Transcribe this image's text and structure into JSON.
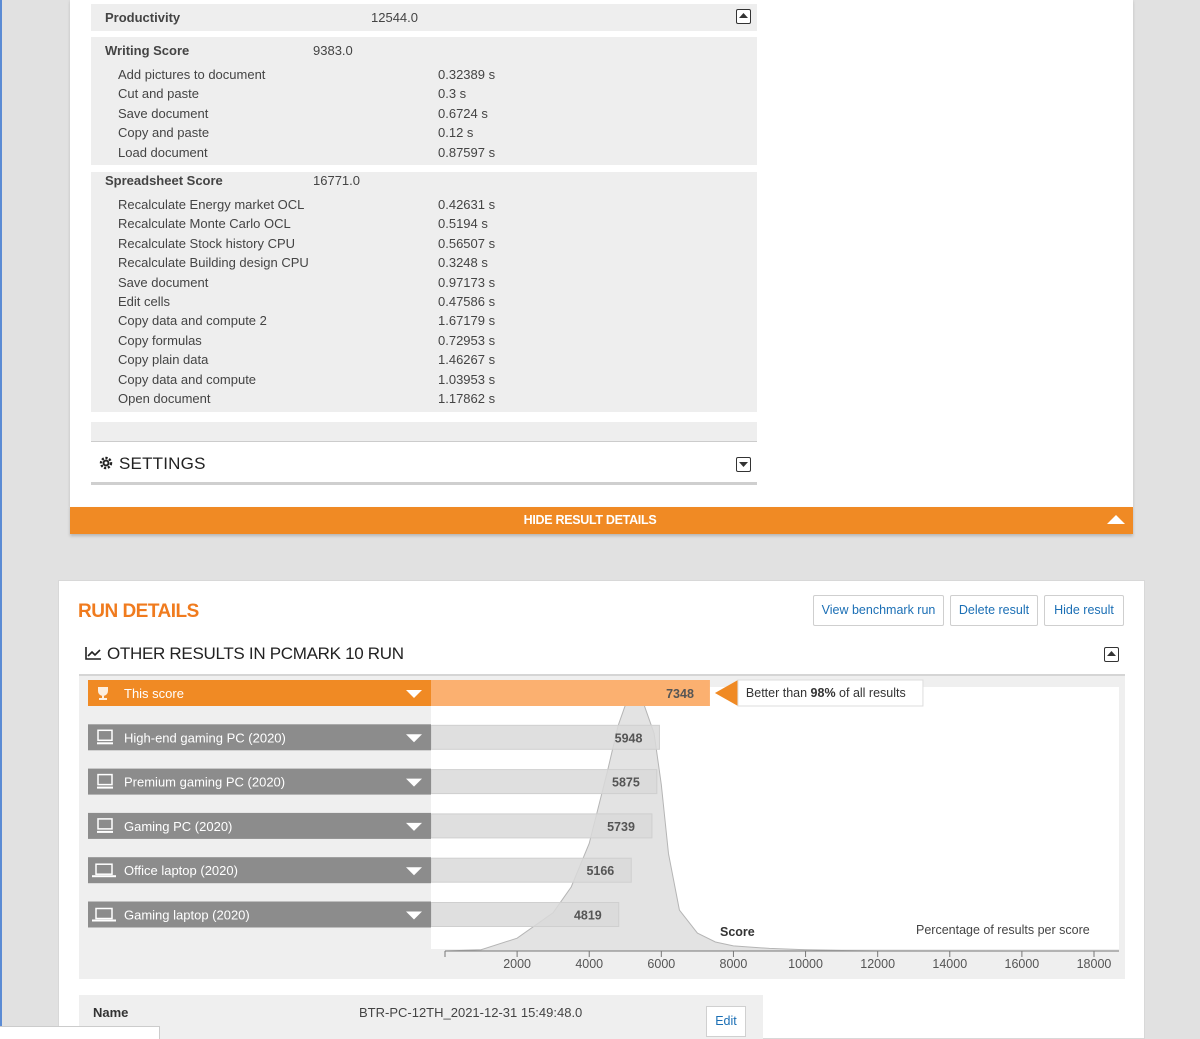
{
  "productivity": {
    "label": "Productivity",
    "value": "12544.0"
  },
  "writing": {
    "title": "Writing Score",
    "score": "9383.0",
    "rows": [
      {
        "name": "Add pictures to document",
        "value": "0.32389 s"
      },
      {
        "name": "Cut and paste",
        "value": "0.3 s"
      },
      {
        "name": "Save document",
        "value": "0.6724 s"
      },
      {
        "name": "Copy and paste",
        "value": "0.12 s"
      },
      {
        "name": "Load document",
        "value": "0.87597 s"
      }
    ]
  },
  "spreadsheet": {
    "title": "Spreadsheet Score",
    "score": "16771.0",
    "rows": [
      {
        "name": "Recalculate Energy market OCL",
        "value": "0.42631 s"
      },
      {
        "name": "Recalculate Monte Carlo OCL",
        "value": "0.5194 s"
      },
      {
        "name": "Recalculate Stock history CPU",
        "value": "0.56507 s"
      },
      {
        "name": "Recalculate Building design CPU",
        "value": "0.3248 s"
      },
      {
        "name": "Save document",
        "value": "0.97173 s"
      },
      {
        "name": "Edit cells",
        "value": "0.47586 s"
      },
      {
        "name": "Copy data and compute 2",
        "value": "1.67179 s"
      },
      {
        "name": "Copy formulas",
        "value": "0.72953 s"
      },
      {
        "name": "Copy plain data",
        "value": "1.46267 s"
      },
      {
        "name": "Copy data and compute",
        "value": "1.03953 s"
      },
      {
        "name": "Open document",
        "value": "1.17862 s"
      }
    ]
  },
  "settings": {
    "title": "SETTINGS"
  },
  "hide_details": {
    "label": "HIDE RESULT DETAILS"
  },
  "run": {
    "title": "RUN DETAILS",
    "buttons": {
      "view": "View benchmark run",
      "delete": "Delete result",
      "hide": "Hide result"
    },
    "other_title": "OTHER RESULTS IN PCMARK 10 RUN",
    "name_label": "Name",
    "name_value": "BTR-PC-12TH_2021-12-31 15:49:48.0",
    "edit": "Edit"
  },
  "colors": {
    "accent": "#f08a24",
    "this_score_bar": "#fbb070",
    "ref_label_bg": "#8c8c8c",
    "ref_bar": "#d9d9d9"
  },
  "chart_data": {
    "type": "bar",
    "axis_label": "Score",
    "density_label": "Percentage of results per score",
    "xlim": [
      0,
      18000
    ],
    "ticks": [
      2000,
      4000,
      6000,
      8000,
      10000,
      12000,
      14000,
      16000,
      18000
    ],
    "this_score": {
      "name": "This score",
      "value": 7348,
      "icon": "trophy-icon",
      "callout_prefix": "Better than ",
      "callout_percent": "98%",
      "callout_suffix": " of all results"
    },
    "references": [
      {
        "name": "High-end gaming PC (2020)",
        "value": 5948,
        "icon": "desktop-icon"
      },
      {
        "name": "Premium gaming PC (2020)",
        "value": 5875,
        "icon": "desktop-icon"
      },
      {
        "name": "Gaming PC (2020)",
        "value": 5739,
        "icon": "desktop-icon"
      },
      {
        "name": "Office laptop (2020)",
        "value": 5166,
        "icon": "laptop-icon"
      },
      {
        "name": "Gaming laptop (2020)",
        "value": 4819,
        "icon": "laptop-icon"
      }
    ],
    "distribution": {
      "x": [
        0,
        1000,
        2000,
        3000,
        3500,
        4000,
        4500,
        4800,
        5000,
        5200,
        5500,
        5800,
        6000,
        6200,
        6500,
        7000,
        7500,
        8000,
        9000,
        10000,
        11000,
        12000,
        18000
      ],
      "y": [
        0,
        0.5,
        5,
        15,
        25,
        42,
        70,
        88,
        96,
        100,
        97,
        85,
        65,
        38,
        16,
        7,
        3.5,
        2,
        1,
        0.5,
        0.2,
        0.05,
        0
      ]
    }
  }
}
